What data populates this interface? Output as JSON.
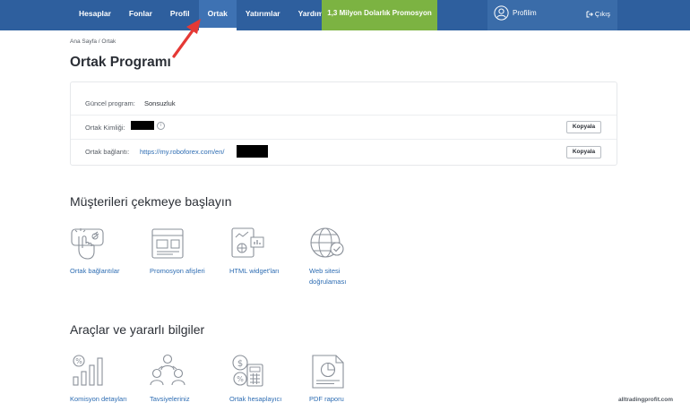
{
  "nav": {
    "items": [
      {
        "label": "Hesaplar",
        "active": false
      },
      {
        "label": "Fonlar",
        "active": false
      },
      {
        "label": "Profil",
        "active": false
      },
      {
        "label": "Ortak",
        "active": true
      },
      {
        "label": "Yatırımlar",
        "active": false
      },
      {
        "label": "Yardım",
        "active": false
      }
    ],
    "promo": "1,3 Milyon Dolarlık Promosyon",
    "profile": "Profilim",
    "logout": "Çıkış"
  },
  "breadcrumb": "Ana Sayfa / Ortak",
  "page_title": "Ortak Programı",
  "card": {
    "program_label": "Güncel program:",
    "program_value": "Sonsuzluk",
    "id_label": "Ortak Kimliği:",
    "link_label": "Ortak bağlantı:",
    "link_value": "https://my.roboforex.com/en/",
    "copy_label": "Kopyala"
  },
  "section1": {
    "title": "Müşterileri çekmeye başlayın",
    "tiles": [
      {
        "label": "Ortak bağlantılar",
        "icon": "partner-links-icon"
      },
      {
        "label": "Promosyon afişleri",
        "icon": "banner-icon"
      },
      {
        "label": "HTML widget'ları",
        "icon": "html-widget-icon"
      },
      {
        "label": "Web sitesi",
        "label2": "doğrulaması",
        "icon": "website-verification-icon"
      }
    ]
  },
  "section2": {
    "title": "Araçlar ve yararlı bilgiler",
    "tiles": [
      {
        "label": "Komisyon detayları",
        "icon": "commission-icon"
      },
      {
        "label": "Tavsiyeleriniz",
        "icon": "referrals-icon"
      },
      {
        "label": "Ortak hesaplayıcı",
        "icon": "calculator-icon"
      },
      {
        "label": "PDF raporu",
        "icon": "pdf-report-icon"
      }
    ]
  },
  "colors": {
    "nav_bg": "#2e5f9e",
    "promo_bg": "#7cb342",
    "link": "#2e6db3",
    "arrow": "#e53935"
  },
  "watermark": "alltradingprofit.com"
}
